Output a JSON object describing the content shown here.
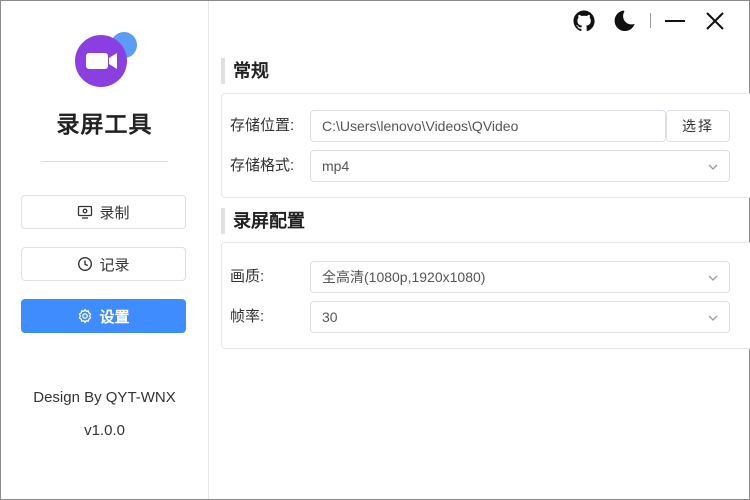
{
  "app": {
    "name": "录屏工具",
    "credit": "Design By QYT-WNX",
    "version": "v1.0.0"
  },
  "nav": [
    {
      "label": "录制",
      "icon": "screen-record-icon"
    },
    {
      "label": "记录",
      "icon": "clock-icon"
    },
    {
      "label": "设置",
      "icon": "gear-icon",
      "active": true
    }
  ],
  "titlebar": {
    "icons": [
      "github-icon",
      "moon-icon",
      "minimize-icon",
      "close-icon"
    ]
  },
  "general": {
    "title": "常规",
    "storage_location_label": "存储位置:",
    "storage_location_value": "C:\\Users\\lenovo\\Videos\\QVideo",
    "choose_label": "选择",
    "storage_format_label": "存储格式:",
    "storage_format_value": "mp4"
  },
  "recording": {
    "title": "录屏配置",
    "quality_label": "画质:",
    "quality_value": "全高清(1080p,1920x1080)",
    "framerate_label": "帧率:",
    "framerate_value": "30"
  },
  "colors": {
    "accent": "#3f8cff",
    "logo_purple": "#8b3fe0",
    "logo_blue": "#5b9cf6"
  }
}
